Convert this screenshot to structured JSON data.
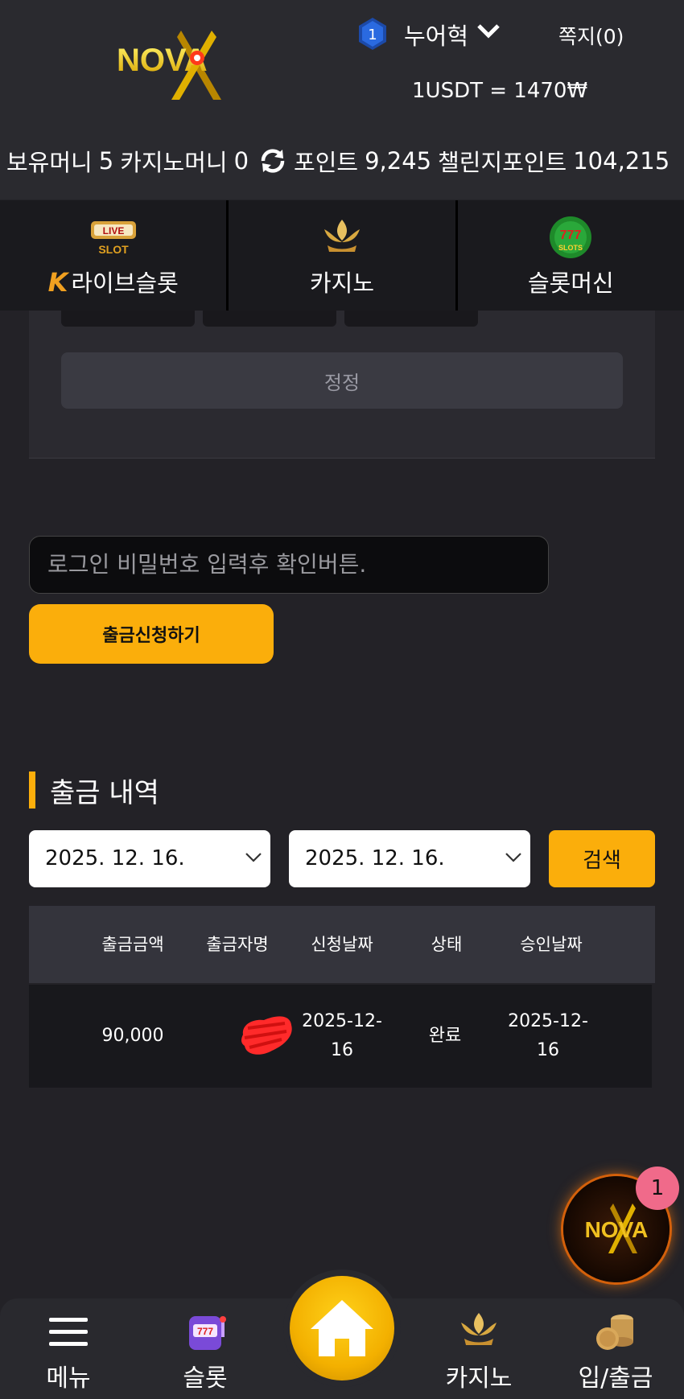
{
  "header": {
    "brand": "NOVA",
    "level": "1",
    "user_name": "누어혁",
    "messages": "쪽지(0)",
    "rate": "1USDT = 1470₩"
  },
  "balances": {
    "money_label": "보유머니",
    "money_value": "5",
    "casino_label": "카지노머니",
    "casino_value": "0",
    "point_label": "포인트",
    "point_value": "9,245",
    "challenge_label": "챌린지포인트",
    "challenge_value": "104,215"
  },
  "categories": [
    {
      "label": "라이브슬롯",
      "icon": "live-slot-icon",
      "prefix": "K"
    },
    {
      "label": "카지노",
      "icon": "kslot-icon"
    },
    {
      "label": "슬롯머신",
      "icon": "777-slots-icon"
    }
  ],
  "form": {
    "correct_label": "정정",
    "password_placeholder": "로그인 비밀번호 입력후 확인버튼.",
    "withdraw_label": "출금신청하기"
  },
  "history": {
    "title": "출금 내역",
    "date_from": "2025. 12. 16.",
    "date_to": "2025. 12. 16.",
    "search_label": "검색",
    "columns": [
      "출금금액",
      "출금자명",
      "신청날짜",
      "상태",
      "승인날짜"
    ],
    "rows": [
      {
        "amount": "90,000",
        "name": "",
        "request_date_1": "2025-12-",
        "request_date_2": "16",
        "status": "완료",
        "approve_date_1": "2025-12-",
        "approve_date_2": "16"
      }
    ]
  },
  "floating": {
    "badge": "1",
    "brand": "NOVA"
  },
  "bottom_nav": {
    "menu": "메뉴",
    "slot": "슬롯",
    "casino": "카지노",
    "deposit": "입/출금"
  },
  "colors": {
    "accent": "#fbae0b",
    "background": "#232227",
    "header": "#2a2a2f"
  }
}
